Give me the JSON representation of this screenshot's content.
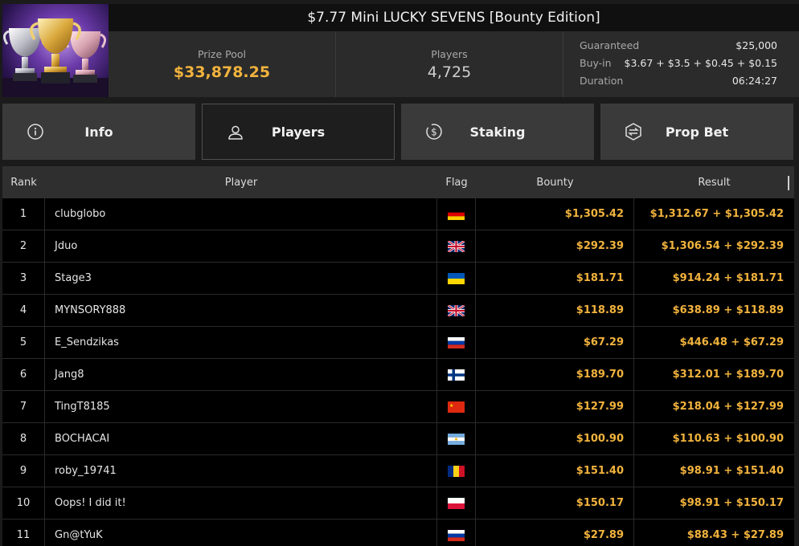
{
  "tournament": {
    "title": "$7.77 Mini LUCKY SEVENS [Bounty Edition]",
    "prize_pool_label": "Prize Pool",
    "prize_pool": "$33,878.25",
    "players_label": "Players",
    "players": "4,725",
    "details": [
      {
        "key": "Guaranteed",
        "value": "$25,000"
      },
      {
        "key": "Buy-in",
        "value": "$3.67 + $3.5 + $0.45 + $0.15"
      },
      {
        "key": "Duration",
        "value": "06:24:27"
      }
    ]
  },
  "tabs": [
    {
      "label": "Info",
      "icon": "info-icon",
      "active": false
    },
    {
      "label": "Players",
      "icon": "user-icon",
      "active": true
    },
    {
      "label": "Staking",
      "icon": "dollar-coin-icon",
      "active": false
    },
    {
      "label": "Prop Bet",
      "icon": "prop-bet-icon",
      "active": false
    }
  ],
  "table": {
    "headers": {
      "rank": "Rank",
      "player": "Player",
      "flag": "Flag",
      "bounty": "Bounty",
      "result": "Result"
    },
    "rows": [
      {
        "rank": "1",
        "player": "clubglobo",
        "flag": "germany-flag",
        "bounty": "$1,305.42",
        "result": "$1,312.67 + $1,305.42"
      },
      {
        "rank": "2",
        "player": "Jduo",
        "flag": "uk-flag",
        "bounty": "$292.39",
        "result": "$1,306.54 + $292.39"
      },
      {
        "rank": "3",
        "player": "Stage3",
        "flag": "ukraine-flag",
        "bounty": "$181.71",
        "result": "$914.24 + $181.71"
      },
      {
        "rank": "4",
        "player": "MYNSORY888",
        "flag": "uk-flag",
        "bounty": "$118.89",
        "result": "$638.89 + $118.89"
      },
      {
        "rank": "5",
        "player": "E_Sendzikas",
        "flag": "russia-flag",
        "bounty": "$67.29",
        "result": "$446.48 + $67.29"
      },
      {
        "rank": "6",
        "player": "Jang8",
        "flag": "finland-flag",
        "bounty": "$189.70",
        "result": "$312.01 + $189.70"
      },
      {
        "rank": "7",
        "player": "TingT8185",
        "flag": "china-flag",
        "bounty": "$127.99",
        "result": "$218.04 + $127.99"
      },
      {
        "rank": "8",
        "player": "BOCHACAI",
        "flag": "argentina-flag",
        "bounty": "$100.90",
        "result": "$110.63 + $100.90"
      },
      {
        "rank": "9",
        "player": "roby_19741",
        "flag": "romania-flag",
        "bounty": "$151.40",
        "result": "$98.91 + $151.40"
      },
      {
        "rank": "10",
        "player": "Oops! I did it!",
        "flag": "poland-flag",
        "bounty": "$150.17",
        "result": "$98.91 + $150.17"
      },
      {
        "rank": "11",
        "player": "Gn@tYuK",
        "flag": "russia-flag",
        "bounty": "$27.89",
        "result": "$88.43 + $27.89"
      }
    ]
  },
  "colors": {
    "accent_gold": "#f2b33d",
    "tab_bg": "#3a3a3a",
    "tab_active_bg": "#1e1e1e"
  }
}
